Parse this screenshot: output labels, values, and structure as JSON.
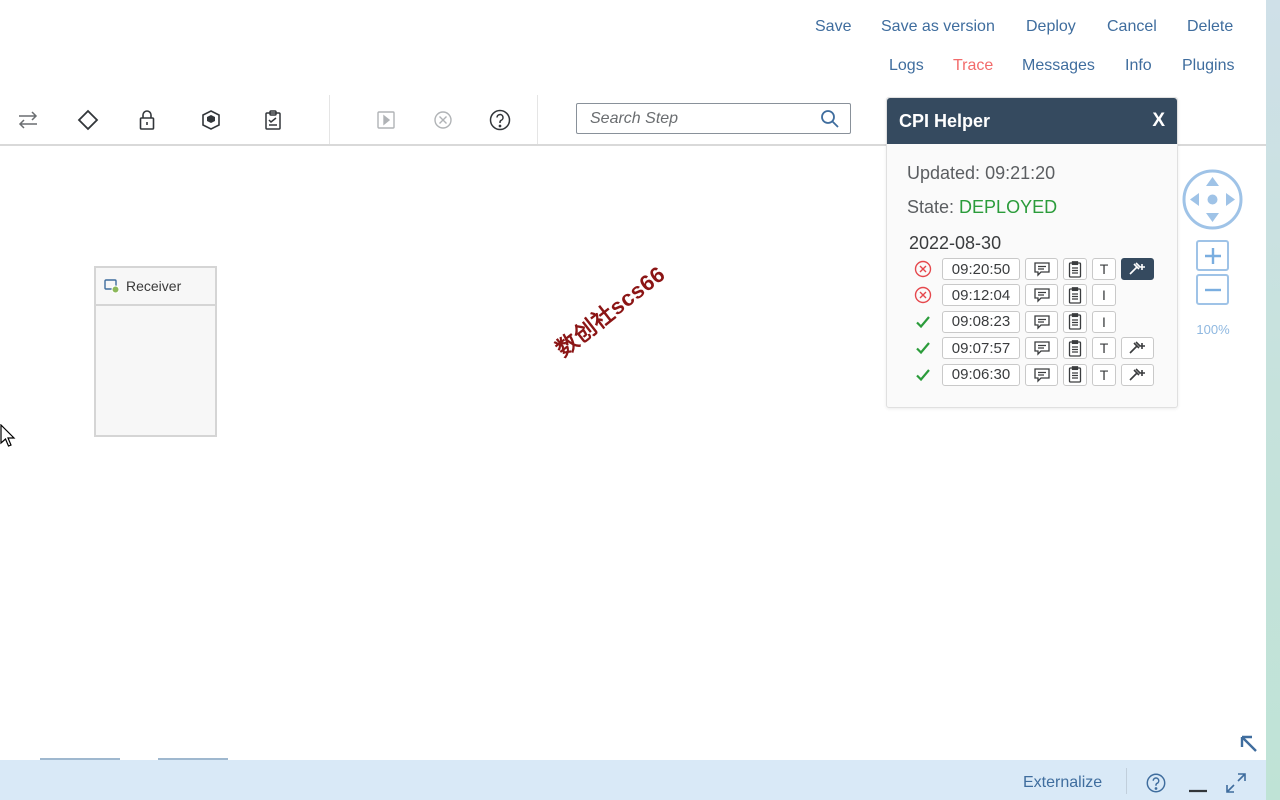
{
  "header_actions": {
    "row1": [
      {
        "id": "save",
        "label": "Save"
      },
      {
        "id": "save-as-version",
        "label": "Save as version"
      },
      {
        "id": "deploy",
        "label": "Deploy"
      },
      {
        "id": "cancel",
        "label": "Cancel"
      },
      {
        "id": "delete",
        "label": "Delete"
      }
    ],
    "row2": [
      {
        "id": "logs",
        "label": "Logs"
      },
      {
        "id": "trace",
        "label": "Trace"
      },
      {
        "id": "messages",
        "label": "Messages"
      },
      {
        "id": "info",
        "label": "Info"
      },
      {
        "id": "plugins",
        "label": "Plugins"
      }
    ]
  },
  "toolbar": {
    "icons": [
      "swap-arrows-icon",
      "diamond-gateway-icon",
      "lock-icon",
      "package-icon",
      "clipboard-icon",
      "play-step-icon",
      "cancel-step-icon",
      "help-icon"
    ],
    "search_placeholder": "Search Step"
  },
  "canvas": {
    "receiver_label": "Receiver",
    "watermark": "数创社scs66",
    "zoom_level": "100%"
  },
  "cpi_helper": {
    "title": "CPI Helper",
    "close_label": "X",
    "updated_label": "Updated:",
    "updated_value": "09:21:20",
    "state_label": "State:",
    "state_value": "DEPLOYED",
    "date": "2022-08-30",
    "runs": [
      {
        "status": "failed",
        "time": "09:20:50",
        "level": "T",
        "has_plugin": true,
        "plugin_active": true
      },
      {
        "status": "failed",
        "time": "09:12:04",
        "level": "I",
        "has_plugin": false,
        "plugin_active": false
      },
      {
        "status": "success",
        "time": "09:08:23",
        "level": "I",
        "has_plugin": false,
        "plugin_active": false
      },
      {
        "status": "success",
        "time": "09:07:57",
        "level": "T",
        "has_plugin": true,
        "plugin_active": false
      },
      {
        "status": "success",
        "time": "09:06:30",
        "level": "T",
        "has_plugin": true,
        "plugin_active": false
      }
    ],
    "colors": {
      "header": "#354a5f",
      "failed": "#e5484d",
      "success": "#2b9c3b"
    }
  },
  "footer": {
    "externalize_label": "Externalize"
  },
  "colors": {
    "link": "#3f6d9e",
    "trace": "#f26b6b",
    "shell": "#354a5f"
  }
}
